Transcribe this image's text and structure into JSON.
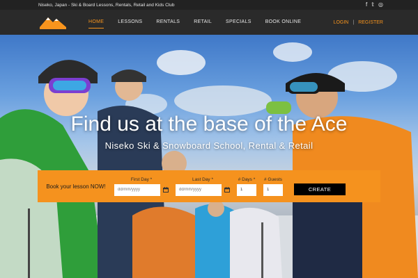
{
  "topbar": {
    "tagline": "Niseko, Japan - Ski & Board Lessons, Rentals, Retail and Kids Club",
    "social_icons": [
      "facebook-icon",
      "twitter-icon",
      "tripadvisor-icon"
    ],
    "social_glyphs": [
      "f",
      "𝕥",
      "◎"
    ]
  },
  "nav": {
    "items": [
      "HOME",
      "LESSONS",
      "RENTALS",
      "RETAIL",
      "SPECIALS",
      "BOOK ONLINE"
    ],
    "active_index": 0,
    "login": "LOGIN",
    "separator": "|",
    "register": "REGISTER"
  },
  "logo": {
    "text": "NISEKO BASE SNOWSPORTS"
  },
  "hero": {
    "title": "Find us at the base of the Ace",
    "subtitle": "Niseko Ski & Snowboard School, Rental & Retail"
  },
  "booking": {
    "label": "Book your lesson NOW!",
    "first_day_label": "First Day *",
    "first_day_placeholder": "dd/mm/yyyy",
    "last_day_label": "Last Day *",
    "last_day_placeholder": "dd/mm/yyyy",
    "days_label": "# Days *",
    "days_value": "1",
    "guests_label": "# Guests",
    "guests_value": "1",
    "create_label": "CREATE"
  },
  "colors": {
    "accent": "#f7941d",
    "booking_bg": "#f5921e",
    "topbar_bg": "#222222",
    "navbar_bg": "#2a2a2a"
  }
}
